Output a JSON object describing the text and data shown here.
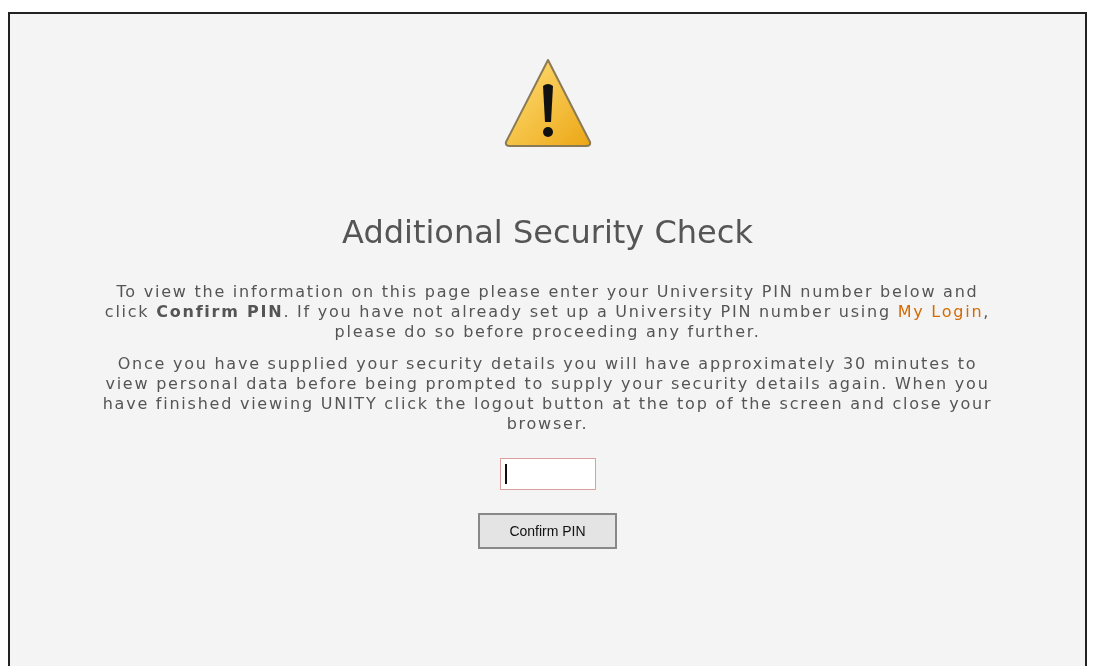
{
  "title": "Additional Security Check",
  "intro": {
    "before": "To view the information on this page please enter your University PIN number below and click **Confirm PIN**. If you have not already set up a University PIN number using",
    "link": "My Login",
    "after": ", please do so before proceeding any further."
  },
  "notice": "Once you have supplied your security details you will have approximately 30 minutes to view personal data before being prompted to supply your security details again. When you have finished viewing UNITY click the logout button at the top of the screen and close your browser.",
  "pin_field": {
    "focused": true
  },
  "button": "Confirm PIN"
}
